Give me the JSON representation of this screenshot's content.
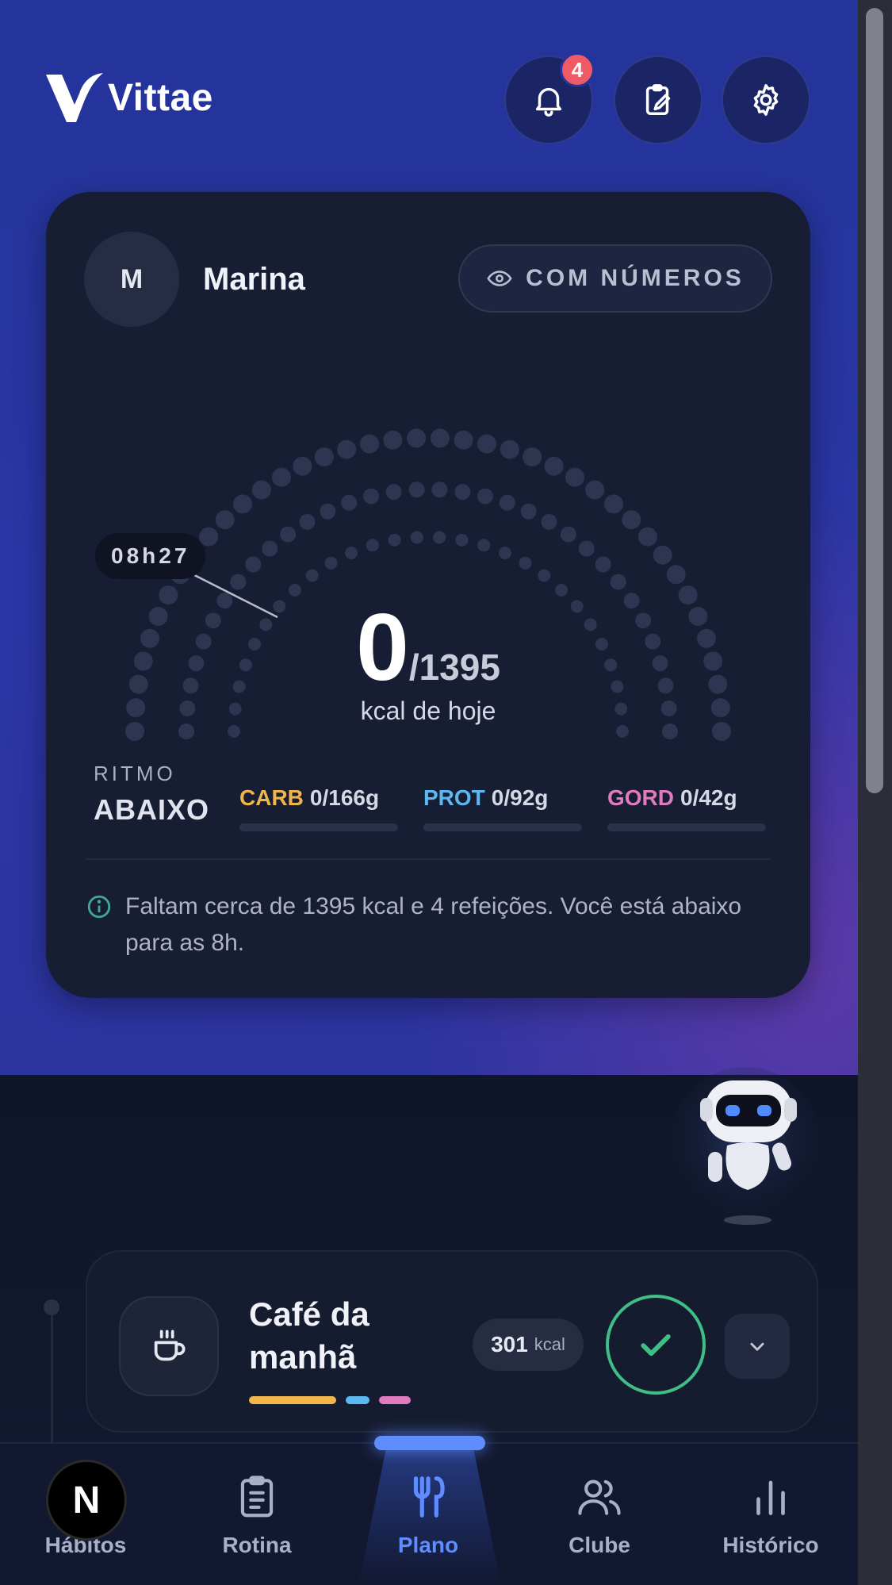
{
  "app": {
    "name": "Vittae"
  },
  "header": {
    "notifications_count": "4",
    "icons": [
      "bell-icon",
      "clipboard-edit-icon",
      "gear-icon"
    ]
  },
  "profile": {
    "initial": "M",
    "name": "Marina",
    "view_mode_label": "COM NÚMEROS"
  },
  "calories": {
    "time": "08h27",
    "consumed": "0",
    "target": "/1395",
    "unit_label": "kcal de hoje"
  },
  "ritmo": {
    "label": "RITMO",
    "value": "ABAIXO"
  },
  "macros": [
    {
      "name": "CARB",
      "value": "0/166g",
      "color": "#f0b64a"
    },
    {
      "name": "PROT",
      "value": "0/92g",
      "color": "#5bb8f0"
    },
    {
      "name": "GORD",
      "value": "0/42g",
      "color": "#e07bbf"
    }
  ],
  "note": {
    "text": "Faltam cerca de 1395 kcal e 4 refeições. Você está abaixo para as 8h."
  },
  "meal": {
    "title": "Café da manhã",
    "kcal_value": "301",
    "kcal_unit": "kcal"
  },
  "nav": [
    {
      "label": "Hábitos",
      "icon": "next-badge-icon"
    },
    {
      "label": "Rotina",
      "icon": "clipboard-list-icon"
    },
    {
      "label": "Plano",
      "icon": "fork-knife-icon",
      "active": true
    },
    {
      "label": "Clube",
      "icon": "users-icon"
    },
    {
      "label": "Histórico",
      "icon": "bar-chart-icon"
    }
  ],
  "dev_badge": {
    "letter": "N"
  },
  "colors": {
    "accent": "#5f8cff",
    "success": "#3fbf86",
    "hero": "#2a36a6"
  }
}
